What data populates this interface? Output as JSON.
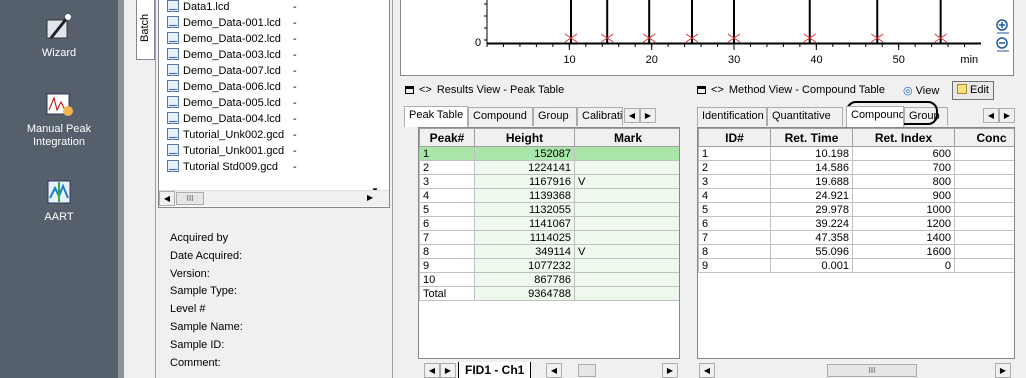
{
  "launcher": {
    "items": [
      {
        "label": "Wizard",
        "icon": "wizard-icon"
      },
      {
        "label": "Manual Peak\nIntegration",
        "icon": "manual-peak-icon"
      },
      {
        "label": "AART",
        "icon": "aart-icon"
      }
    ]
  },
  "batch_tab": {
    "label": "Batch"
  },
  "files": [
    {
      "name": "Data1.lcd",
      "status": "-"
    },
    {
      "name": "Demo_Data-001.lcd",
      "status": "-"
    },
    {
      "name": "Demo_Data-002.lcd",
      "status": "-"
    },
    {
      "name": "Demo_Data-003.lcd",
      "status": "-"
    },
    {
      "name": "Demo_Data-007.lcd",
      "status": "-"
    },
    {
      "name": "Demo_Data-006.lcd",
      "status": "-"
    },
    {
      "name": "Demo_Data-005.lcd",
      "status": "-"
    },
    {
      "name": "Demo_Data-004.lcd",
      "status": "-"
    },
    {
      "name": "Tutorial_Unk002.gcd",
      "status": "-"
    },
    {
      "name": "Tutorial_Unk001.gcd",
      "status": "-"
    },
    {
      "name": "Tutorial Std009.gcd",
      "status": "-"
    }
  ],
  "file_scroll_thumb": "III",
  "sample_info": [
    "Acquired by",
    "Date Acquired:",
    "Version:",
    "Sample Type:",
    "Level #",
    "Sample Name:",
    "Sample ID:",
    "Comment:"
  ],
  "chart_data": {
    "type": "line",
    "x_ticks": [
      "10",
      "20",
      "30",
      "40",
      "50"
    ],
    "x_unit": "min",
    "y_ticks": [
      "0"
    ],
    "peaks_min": [
      10.2,
      14.6,
      19.7,
      24.9,
      30.0,
      39.2,
      47.4,
      55.1
    ]
  },
  "results_panel": {
    "title": "Results View - Peak Table",
    "tabs": [
      "Peak Table",
      "Compound",
      "Group",
      "Calibrati"
    ],
    "columns": [
      "Peak#",
      "Height",
      "Mark"
    ],
    "rows": [
      {
        "peak": "1",
        "height": "152087",
        "mark": ""
      },
      {
        "peak": "2",
        "height": "1224141",
        "mark": ""
      },
      {
        "peak": "3",
        "height": "1167916",
        "mark": "V"
      },
      {
        "peak": "4",
        "height": "1139368",
        "mark": ""
      },
      {
        "peak": "5",
        "height": "1132055",
        "mark": ""
      },
      {
        "peak": "6",
        "height": "1141067",
        "mark": ""
      },
      {
        "peak": "7",
        "height": "1114025",
        "mark": ""
      },
      {
        "peak": "8",
        "height": "349114",
        "mark": "V"
      },
      {
        "peak": "9",
        "height": "1077232",
        "mark": ""
      },
      {
        "peak": "10",
        "height": "867786",
        "mark": ""
      }
    ],
    "total": {
      "label": "Total",
      "height": "9364788"
    },
    "sheet_tab": "FID1 - Ch1"
  },
  "method_panel": {
    "title": "Method View - Compound Table",
    "view_label": "View",
    "edit_label": "Edit",
    "tabs": [
      "Identification",
      "Quantitative",
      "Compound",
      "Group"
    ],
    "columns": [
      "ID#",
      "Ret. Time",
      "Ret. Index",
      "Conc"
    ],
    "rows": [
      {
        "id": "1",
        "rt": "10.198",
        "ri": "600"
      },
      {
        "id": "2",
        "rt": "14.586",
        "ri": "700"
      },
      {
        "id": "3",
        "rt": "19.688",
        "ri": "800"
      },
      {
        "id": "4",
        "rt": "24.921",
        "ri": "900"
      },
      {
        "id": "5",
        "rt": "29.978",
        "ri": "1000"
      },
      {
        "id": "6",
        "rt": "39.224",
        "ri": "1200"
      },
      {
        "id": "7",
        "rt": "47.358",
        "ri": "1400"
      },
      {
        "id": "8",
        "rt": "55.096",
        "ri": "1600"
      },
      {
        "id": "9",
        "rt": "0.001",
        "ri": "0"
      }
    ],
    "scroll_thumb": "III"
  },
  "colors": {
    "launcher_bg": "#56606c",
    "selected_row": "#a9e5a9",
    "row_tint": "#eef9ee",
    "peak_marker": "#e03030"
  }
}
